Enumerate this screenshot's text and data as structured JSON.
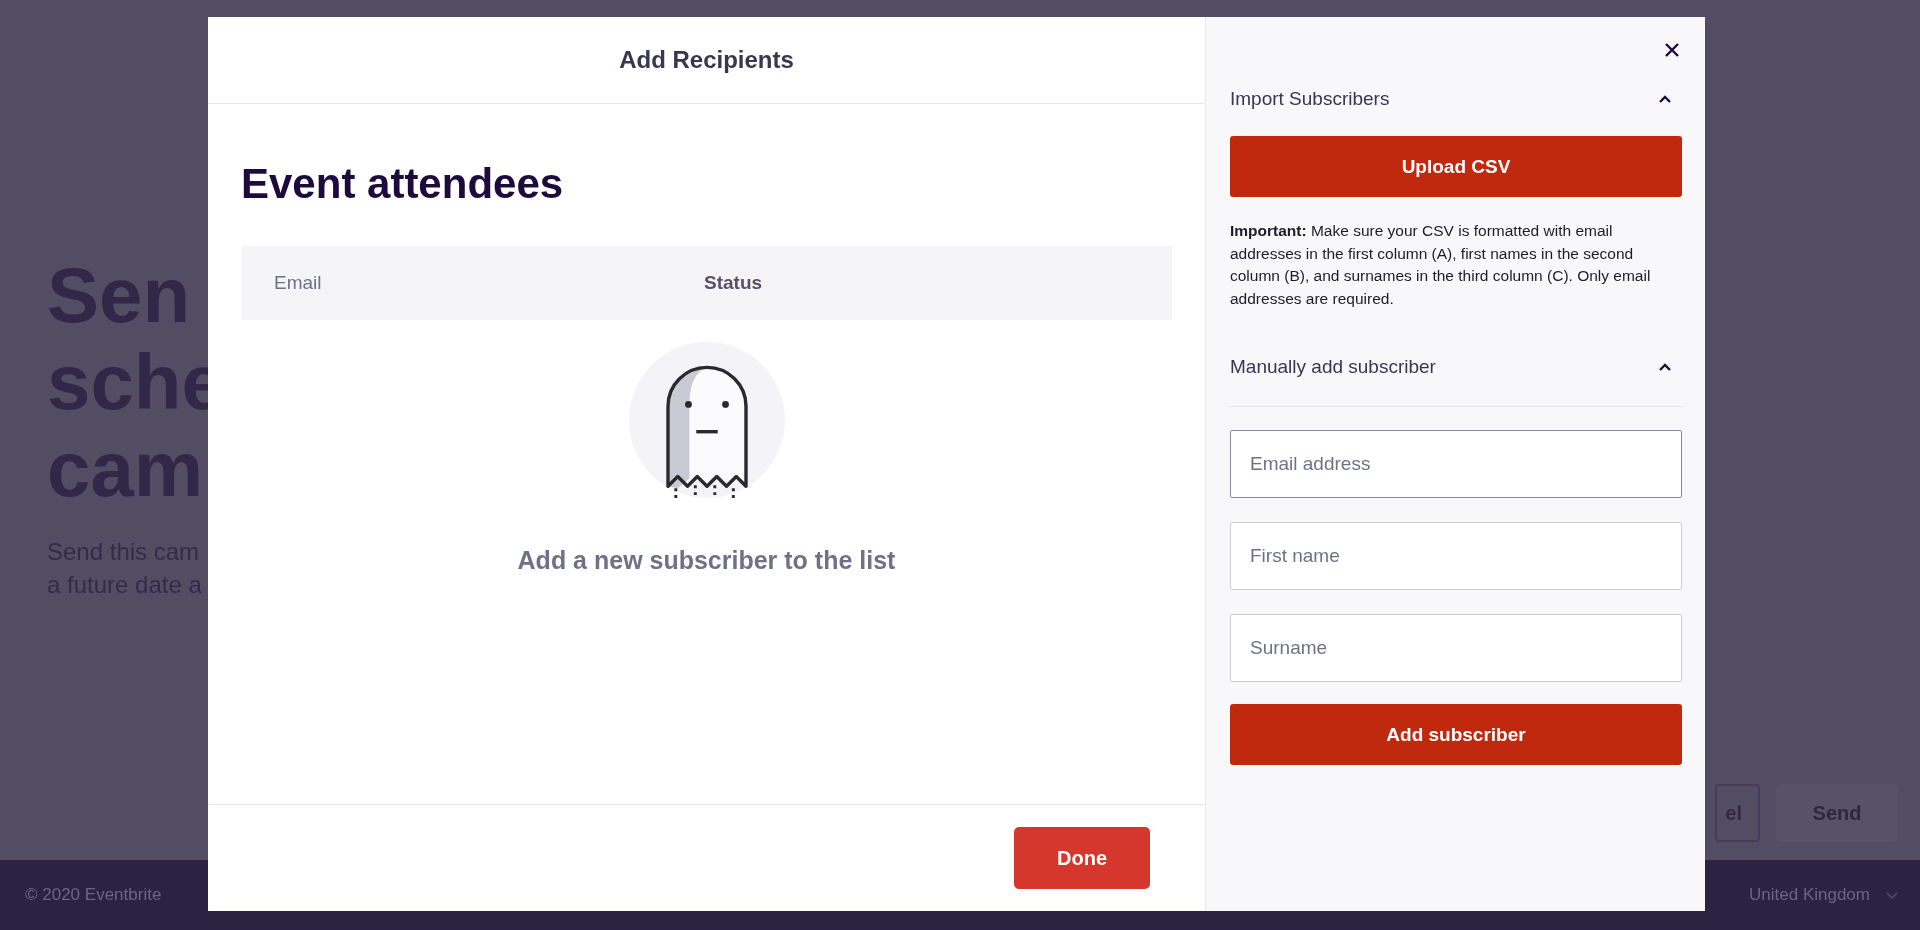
{
  "background_page": {
    "heading_lines": [
      "Sen",
      "sche",
      "cam"
    ],
    "description_lines": [
      "Send this cam",
      "a future date a"
    ],
    "buttons": [
      {
        "label": "el",
        "kind": "outline"
      },
      {
        "label": "Send",
        "kind": "disabled"
      }
    ],
    "footer": {
      "copyright": "© 2020 Eventbrite",
      "region": "United Kingdom"
    }
  },
  "modal": {
    "title": "Add Recipients",
    "list_title": "Event attendees",
    "columns": [
      "Email",
      "Status"
    ],
    "empty_message": "Add a new subscriber to the list",
    "done_button": "Done",
    "side_panel": {
      "sections": [
        {
          "title": "Import Subscribers",
          "expanded": true,
          "kind": "upload",
          "button": "Upload CSV",
          "note": "**Important:** Make sure your CSV is formatted with email addresses in the first column (A), first names in the second column (B), and surnames in the third column (C). Only email addresses are required."
        },
        {
          "title": "Manually add subscriber",
          "expanded": true,
          "kind": "form",
          "fields": [
            {
              "placeholder": "Email address"
            },
            {
              "placeholder": "First name"
            },
            {
              "placeholder": "Surname"
            }
          ],
          "button": "Add subscriber"
        }
      ]
    }
  }
}
